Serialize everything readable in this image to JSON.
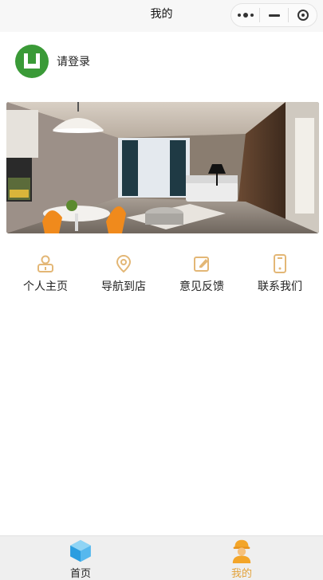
{
  "navbar": {
    "title": "我的"
  },
  "login": {
    "text": "请登录"
  },
  "banner": {
    "icon": "living-room-photo"
  },
  "menu": {
    "items": [
      {
        "label": "个人主页",
        "icon": "person-icon"
      },
      {
        "label": "导航到店",
        "icon": "location-pin-icon"
      },
      {
        "label": "意见反馈",
        "icon": "edit-icon"
      },
      {
        "label": "联系我们",
        "icon": "phone-icon"
      }
    ],
    "icon_color": "#e3b776"
  },
  "tabbar": {
    "tabs": [
      {
        "label": "首页",
        "icon": "cube-icon",
        "active": false
      },
      {
        "label": "我的",
        "icon": "worker-icon",
        "active": true
      }
    ],
    "active_color": "#e2a23a"
  }
}
